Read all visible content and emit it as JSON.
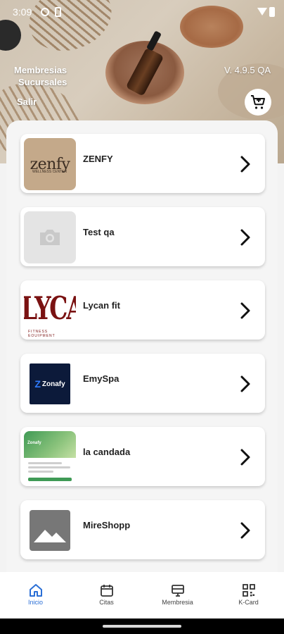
{
  "status_bar": {
    "time": "3:09"
  },
  "header": {
    "membresias": "Membresias",
    "sucursales": "Sucursales",
    "salir": "Salir",
    "version": "V. 4.9.5 QA",
    "cart_icon": "cart-icon"
  },
  "list": {
    "items": [
      {
        "name": "ZENFY",
        "logo_text": "zenfy",
        "logo_sub": "WELLNESS CENTER"
      },
      {
        "name": "Test qa"
      },
      {
        "name": "Lycan fit",
        "logo_text": "LYCAN",
        "logo_sub": "FITNESS EQUIPMENT"
      },
      {
        "name": "EmySpa",
        "logo_text": "Zonafy"
      },
      {
        "name": "la candada",
        "logo_text": "Zonafy"
      },
      {
        "name": "MireShopp"
      }
    ]
  },
  "bottom_nav": {
    "items": [
      {
        "label": "Inicio",
        "icon": "home-icon",
        "active": true
      },
      {
        "label": "Citas",
        "icon": "calendar-icon",
        "active": false
      },
      {
        "label": "Membresia",
        "icon": "membership-icon",
        "active": false
      },
      {
        "label": "K-Card",
        "icon": "qr-icon",
        "active": false
      }
    ]
  },
  "colors": {
    "accent": "#2b6fd6",
    "lycan_red": "#7a1212",
    "emyspa_navy": "#0c1a3a"
  }
}
